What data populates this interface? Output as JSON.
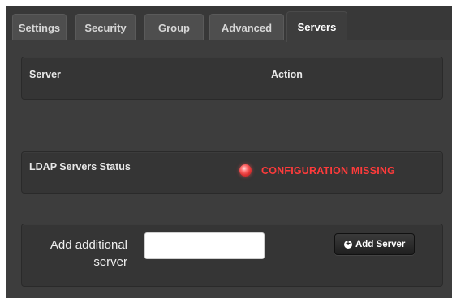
{
  "tabs": [
    {
      "label": "Settings",
      "active": false
    },
    {
      "label": "Security",
      "active": false
    },
    {
      "label": "Group",
      "active": false
    },
    {
      "label": "Advanced",
      "active": false
    },
    {
      "label": "Servers",
      "active": true
    }
  ],
  "server_table": {
    "columns": [
      "Server",
      "Action"
    ]
  },
  "ldap_status": {
    "label": "LDAP Servers Status",
    "status_text": "CONFIGURATION MISSING",
    "status_color": "#ff3b3b"
  },
  "add_server": {
    "label_line1": "Add additional",
    "label_line2": "server",
    "input_value": "",
    "button_label": "Add Server"
  },
  "icons": {
    "status": "status-led-red-icon",
    "add": "plus-circle-icon"
  }
}
